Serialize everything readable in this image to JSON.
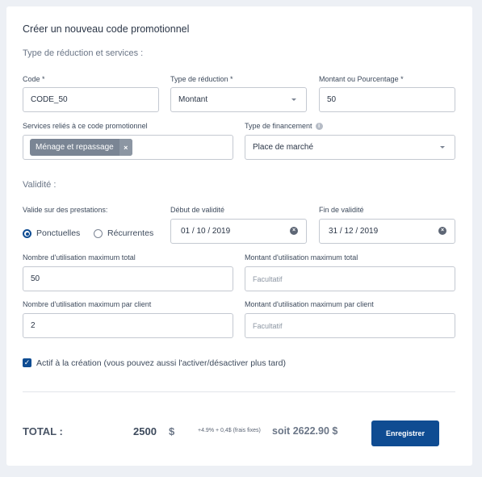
{
  "form": {
    "title": "Créer un nouveau code promotionnel",
    "section_discount": "Type de réduction et services :",
    "section_validity": "Validité :"
  },
  "fields": {
    "code": {
      "label": "Code *",
      "value": "CODE_50"
    },
    "discount_type": {
      "label": "Type de réduction *",
      "value": "Montant"
    },
    "amount": {
      "label": "Montant ou Pourcentage *",
      "value": "50"
    },
    "services": {
      "label": "Services reliés à ce code promotionnel",
      "chip": "Ménage et repassage",
      "chip_remove": "×"
    },
    "financing": {
      "label": "Type de financement",
      "value": "Place de marché"
    },
    "applies_to": {
      "label": "Valide sur des prestations:",
      "option1": "Ponctuelles",
      "option2": "Récurrentes",
      "selected": "Ponctuelles"
    },
    "start_date": {
      "label": "Début de validité",
      "value": "01 / 10 / 2019"
    },
    "end_date": {
      "label": "Fin de validité",
      "value": "31 / 12 / 2019"
    },
    "max_uses_total": {
      "label": "Nombre d'utilisation maximum total",
      "value": "50"
    },
    "max_amount_total": {
      "label": "Montant d'utilisation maximum total",
      "placeholder": "Facultatif"
    },
    "max_uses_client": {
      "label": "Nombre d'utilisation maximum par client",
      "value": "2"
    },
    "max_amount_client": {
      "label": "Montant d'utilisation maximum par client",
      "placeholder": "Facultatif"
    },
    "active": {
      "label": "Actif à la création (vous pouvez aussi l'activer/désactiver plus tard)",
      "checked": true
    }
  },
  "footer": {
    "total_label": "TOTAL :",
    "total_value": "2500",
    "currency": "$",
    "fees_note": "+4.9% + 0,4$ (frais fixes)",
    "soit": "soit",
    "grand_total": "2622.90 $",
    "save_button": "Enregistrer"
  },
  "colors": {
    "primary": "#0f4c92",
    "background": "#edf0f5",
    "border": "#c4c9d1",
    "chip": "#7a8594"
  }
}
